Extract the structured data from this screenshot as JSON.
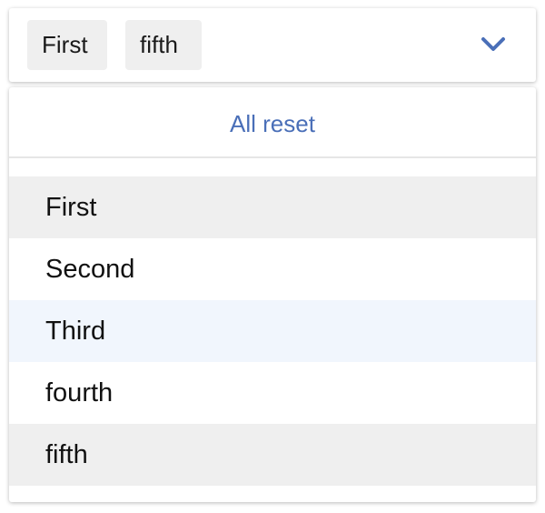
{
  "select": {
    "chips": [
      "First",
      "fifth"
    ],
    "indicator_icon": "chevron-down-icon",
    "accent_color": "#4a6fb8"
  },
  "menu": {
    "reset_label": "All reset",
    "options": [
      {
        "label": "First",
        "state": "selected"
      },
      {
        "label": "Second",
        "state": "normal"
      },
      {
        "label": "Third",
        "state": "hovered"
      },
      {
        "label": "fourth",
        "state": "normal"
      },
      {
        "label": "fifth",
        "state": "selected"
      }
    ]
  }
}
